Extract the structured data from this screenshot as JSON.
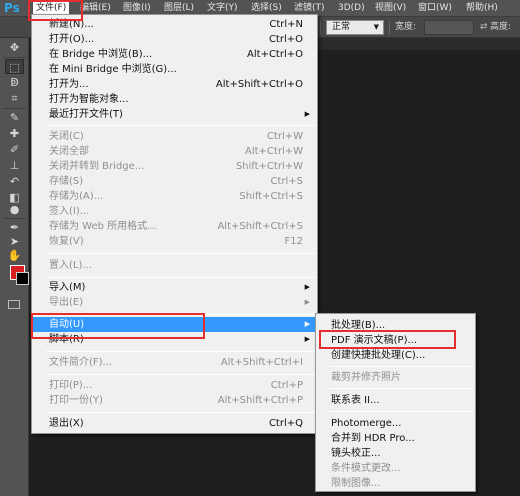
{
  "app": {
    "logo": "Ps"
  },
  "menubar": {
    "items": [
      "文件(F)",
      "编辑(E)",
      "图像(I)",
      "图层(L)",
      "文字(Y)",
      "选择(S)",
      "滤镜(T)",
      "3D(D)",
      "视图(V)",
      "窗口(W)",
      "帮助(H)"
    ]
  },
  "options": {
    "mode": "正常",
    "width_label": "宽度:",
    "height_label": "高度:"
  },
  "toolbar": {
    "foreground_color": "#d91f1f",
    "background_color": "#000000",
    "icons": [
      "move-icon",
      "marquee-icon",
      "lasso-icon",
      "crop-icon",
      "eyedropper-icon",
      "healing-brush-icon",
      "brush-icon",
      "clone-stamp-icon",
      "history-brush-icon",
      "eraser-icon",
      "paint-bucket-icon",
      "blur-icon",
      "dodge-icon",
      "pen-icon",
      "type-icon",
      "path-selection-icon",
      "shape-icon",
      "hand-icon",
      "zoom-icon",
      "quick-mask-icon",
      "screen-mode-icon"
    ]
  },
  "file_menu": {
    "items": [
      {
        "label": "新建(N)...",
        "shortcut": "Ctrl+N"
      },
      {
        "label": "打开(O)...",
        "shortcut": "Ctrl+O"
      },
      {
        "label": "在 Bridge 中浏览(B)...",
        "shortcut": "Alt+Ctrl+O"
      },
      {
        "label": "在 Mini Bridge 中浏览(G)...",
        "shortcut": ""
      },
      {
        "label": "打开为...",
        "shortcut": "Alt+Shift+Ctrl+O"
      },
      {
        "label": "打开为智能对象...",
        "shortcut": ""
      },
      {
        "label": "最近打开文件(T)",
        "shortcut": ""
      },
      {
        "label": "关闭(C)",
        "shortcut": "Ctrl+W"
      },
      {
        "label": "关闭全部",
        "shortcut": "Alt+Ctrl+W"
      },
      {
        "label": "关闭并转到 Bridge...",
        "shortcut": "Shift+Ctrl+W"
      },
      {
        "label": "存储(S)",
        "shortcut": "Ctrl+S"
      },
      {
        "label": "存储为(A)...",
        "shortcut": "Shift+Ctrl+S"
      },
      {
        "label": "签入(I)...",
        "shortcut": ""
      },
      {
        "label": "存储为 Web 所用格式...",
        "shortcut": "Alt+Shift+Ctrl+S"
      },
      {
        "label": "恢复(V)",
        "shortcut": "F12"
      },
      {
        "label": "置入(L)...",
        "shortcut": ""
      },
      {
        "label": "导入(M)",
        "shortcut": ""
      },
      {
        "label": "导出(E)",
        "shortcut": ""
      },
      {
        "label": "自动(U)",
        "shortcut": ""
      },
      {
        "label": "脚本(R)",
        "shortcut": ""
      },
      {
        "label": "文件简介(F)...",
        "shortcut": "Alt+Shift+Ctrl+I"
      },
      {
        "label": "打印(P)...",
        "shortcut": "Ctrl+P"
      },
      {
        "label": "打印一份(Y)",
        "shortcut": "Alt+Shift+Ctrl+P"
      },
      {
        "label": "退出(X)",
        "shortcut": "Ctrl+Q"
      }
    ]
  },
  "auto_submenu": {
    "items": [
      {
        "label": "批处理(B)..."
      },
      {
        "label": "PDF 演示文稿(P)..."
      },
      {
        "label": "创建快捷批处理(C)..."
      },
      {
        "label": "裁剪并修齐照片"
      },
      {
        "label": "联系表 II..."
      },
      {
        "label": "Photomerge..."
      },
      {
        "label": "合并到 HDR Pro..."
      },
      {
        "label": "镜头校正..."
      },
      {
        "label": "条件模式更改..."
      },
      {
        "label": "限制图像..."
      }
    ]
  }
}
